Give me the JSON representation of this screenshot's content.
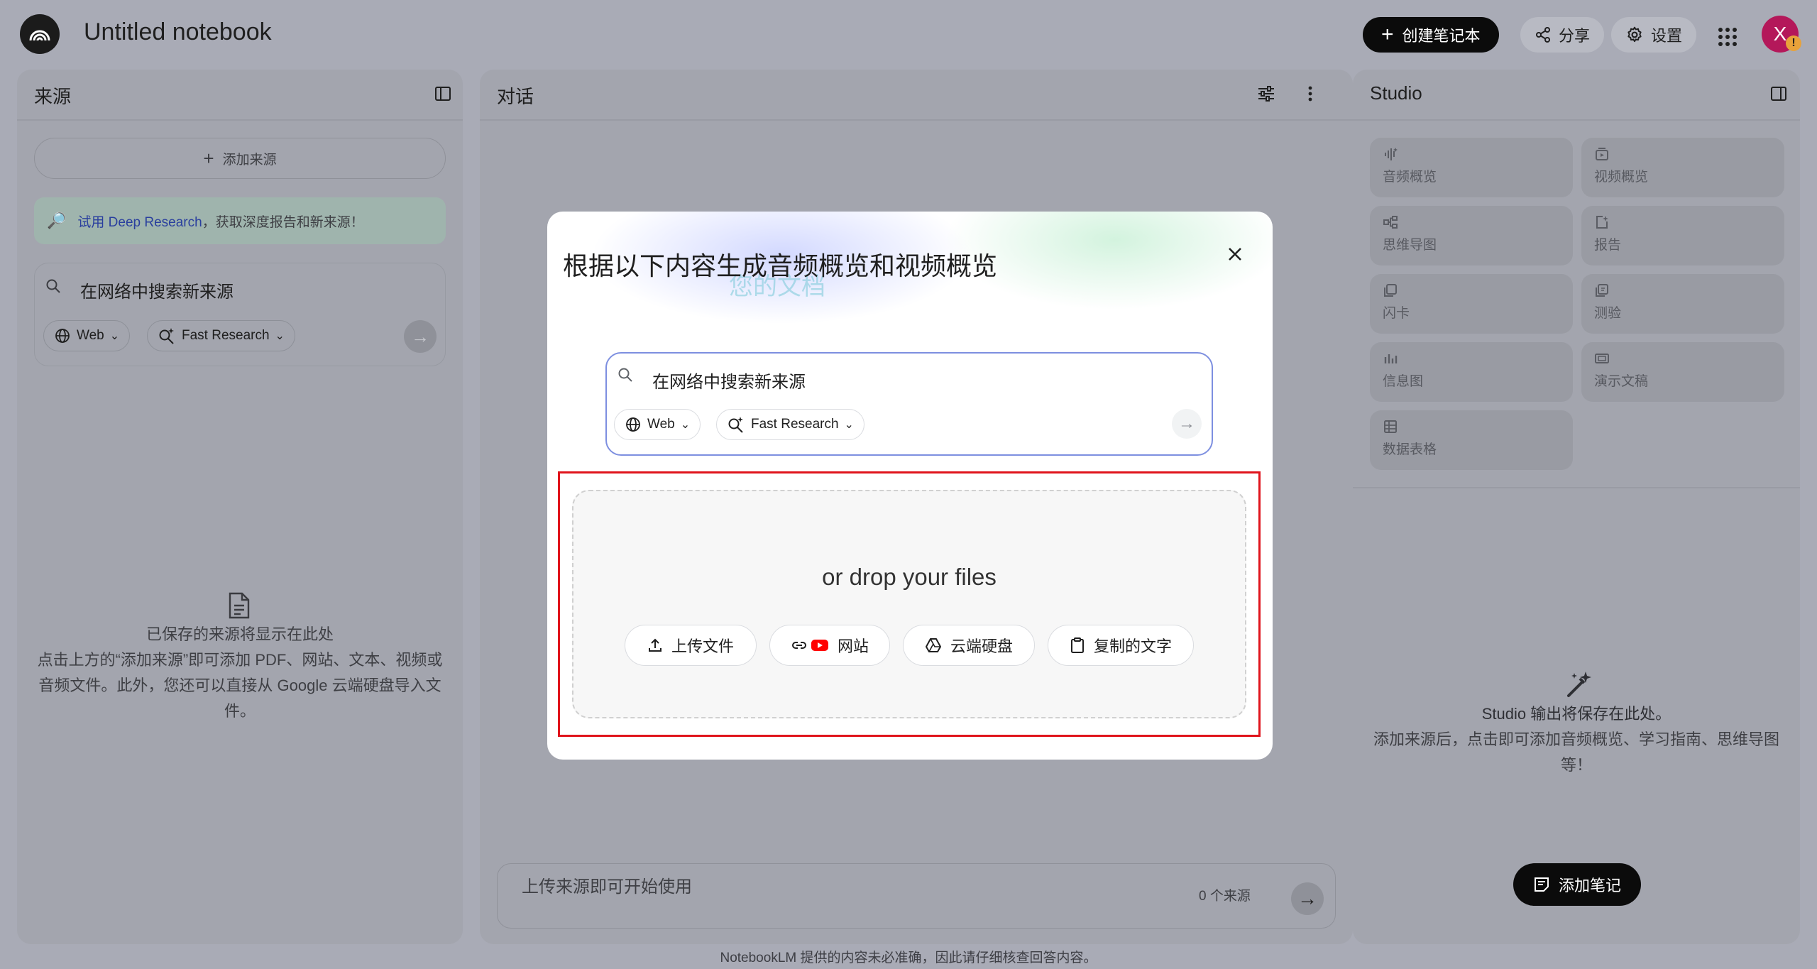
{
  "header": {
    "notebook_title": "Untitled notebook",
    "create_label": "创建笔记本",
    "share_label": "分享",
    "settings_label": "设置",
    "avatar_letter": "X",
    "avatar_badge": "!"
  },
  "sources": {
    "title": "来源",
    "add_label": "添加来源",
    "deep_research_link": "试用 Deep Research",
    "deep_research_rest": "，获取深度报告和新来源！",
    "search_placeholder": "在网络中搜索新来源",
    "web_chip": "Web",
    "research_chip": "Fast Research",
    "empty_title": "已保存的来源将显示在此处",
    "empty_desc_1": "点击上方的“添加来源”即可添加 PDF、网站、文本、视频或",
    "empty_desc_2": "音频文件。此外，您还可以直接从 Google 云端硬盘导入文",
    "empty_desc_3": "件。"
  },
  "chat": {
    "title": "对话",
    "input_placeholder": "上传来源即可开始使用",
    "source_count": "0 个来源"
  },
  "studio": {
    "title": "Studio",
    "tiles": [
      {
        "label": "音频概览",
        "icon": "audio-waves-icon"
      },
      {
        "label": "视频概览",
        "icon": "video-icon"
      },
      {
        "label": "思维导图",
        "icon": "mind-map-icon"
      },
      {
        "label": "报告",
        "icon": "report-icon"
      },
      {
        "label": "闪卡",
        "icon": "flashcard-icon"
      },
      {
        "label": "测验",
        "icon": "quiz-icon"
      },
      {
        "label": "信息图",
        "icon": "infographic-icon"
      },
      {
        "label": "演示文稿",
        "icon": "slides-icon"
      },
      {
        "label": "数据表格",
        "icon": "table-icon"
      }
    ],
    "empty_title": "Studio 输出将保存在此处。",
    "empty_desc_1": "添加来源后，点击即可添加音频概览、学习指南、思维导图",
    "empty_desc_2": "等！",
    "add_note_label": "添加笔记"
  },
  "modal": {
    "title": "根据以下内容生成音频概览和视频概览",
    "ghost_text": "您的文档",
    "search_placeholder": "在网络中搜索新来源",
    "web_chip": "Web",
    "research_chip": "Fast Research",
    "drop_text": "or drop your files",
    "upload_label": "上传文件",
    "website_label": "网站",
    "drive_label": "云端硬盘",
    "paste_label": "复制的文字"
  },
  "footer": {
    "disclaimer": "NotebookLM 提供的内容未必准确，因此请仔细核查回答内容。"
  }
}
